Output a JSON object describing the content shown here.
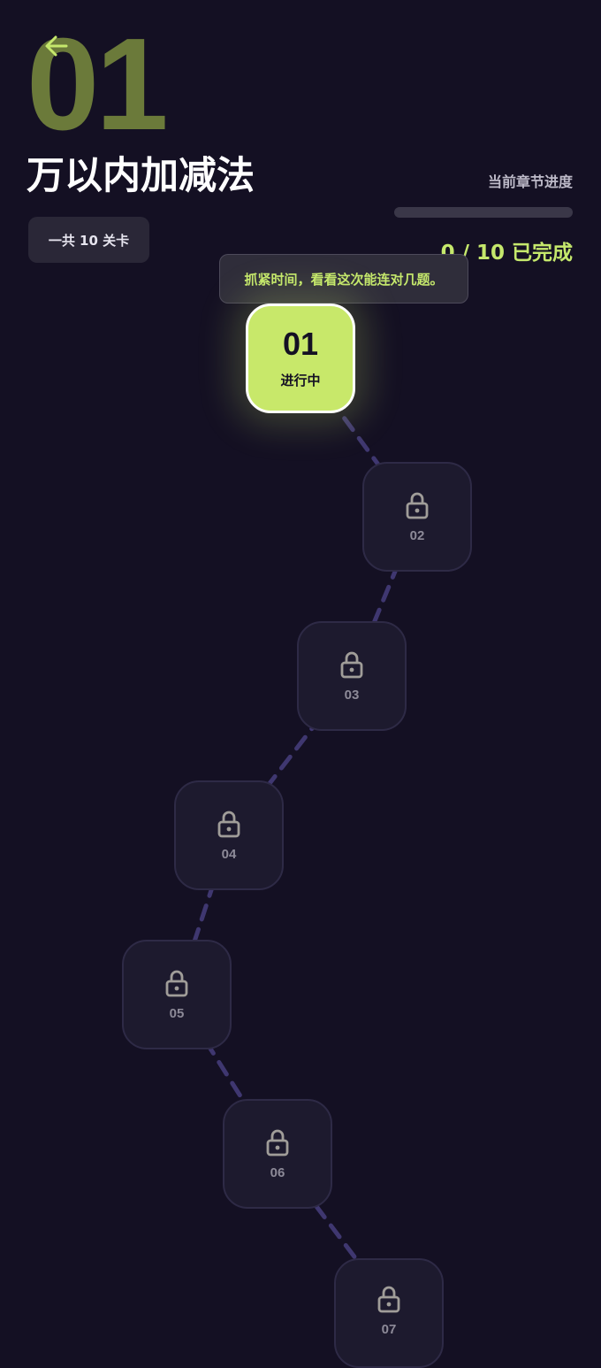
{
  "header": {
    "chapter_number": "01",
    "title": "万以内加减法",
    "level_count": "一共 10 关卡",
    "back_icon": "arrow-left-icon",
    "accent_color": "#c5e86c"
  },
  "progress": {
    "label": "当前章节进度",
    "text": "0 / 10 已完成",
    "completed": 0,
    "total": 10,
    "fraction": 0
  },
  "tooltip": {
    "text": "抓紧时间，看看这次能连对几题。"
  },
  "levels": [
    {
      "number": "01",
      "status": "进行中",
      "state": "current"
    },
    {
      "number": "02",
      "state": "locked",
      "icon": "lock-icon"
    },
    {
      "number": "03",
      "state": "locked",
      "icon": "lock-icon"
    },
    {
      "number": "04",
      "state": "locked",
      "icon": "lock-icon"
    },
    {
      "number": "05",
      "state": "locked",
      "icon": "lock-icon"
    },
    {
      "number": "06",
      "state": "locked",
      "icon": "lock-icon"
    },
    {
      "number": "07",
      "state": "locked",
      "icon": "lock-icon"
    }
  ]
}
